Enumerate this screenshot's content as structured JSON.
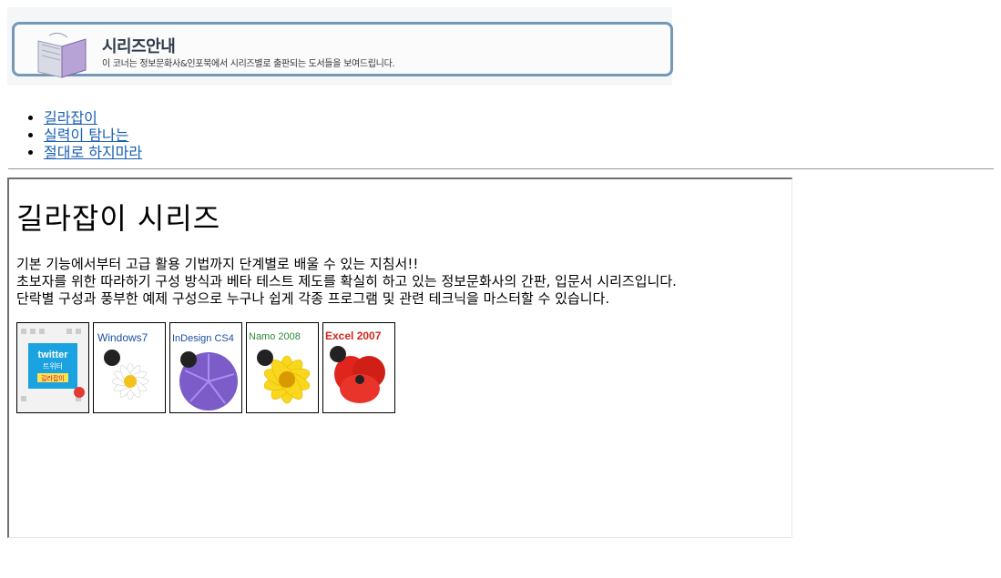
{
  "banner": {
    "title": "시리즈안내",
    "subtitle": "이 코너는 정보문화사&인포북에서 시리즈별로 출판되는 도서들을 보여드립니다."
  },
  "nav": {
    "items": [
      {
        "label": "길라잡이"
      },
      {
        "label": "실력이 탐나는"
      },
      {
        "label": "절대로 하지마라"
      }
    ]
  },
  "series": {
    "title": "길라잡이 시리즈",
    "description": [
      "기본 기능에서부터 고급 활용 기법까지 단계별로 배울 수 있는 지침서!!",
      "초보자를 위한 따라하기 구성 방식과 베타 테스트 제도를 확실히 하고 있는 정보문화사의 간판, 입문서 시리즈입니다.",
      "단락별 구성과 풍부한 예제 구성으로 누구나 쉽게 각종 프로그램 및 관련 테크닉을 마스터할 수 있습니다."
    ],
    "books": [
      {
        "name": "twitter",
        "cover_text": "twitter",
        "sub_text": "트위터",
        "tag_text": "길라잡이",
        "accent": "#1aa3e0"
      },
      {
        "name": "windows7",
        "cover_text": "Windows7",
        "accent": "#1c4fa3"
      },
      {
        "name": "indesign-cs4",
        "cover_text": "InDesign CS4",
        "accent": "#1c4fa3"
      },
      {
        "name": "namo-2008",
        "cover_text": "Namo 2008",
        "accent": "#2e8b3a"
      },
      {
        "name": "excel-2007",
        "cover_text": "Excel 2007",
        "accent": "#d6261e"
      }
    ]
  }
}
